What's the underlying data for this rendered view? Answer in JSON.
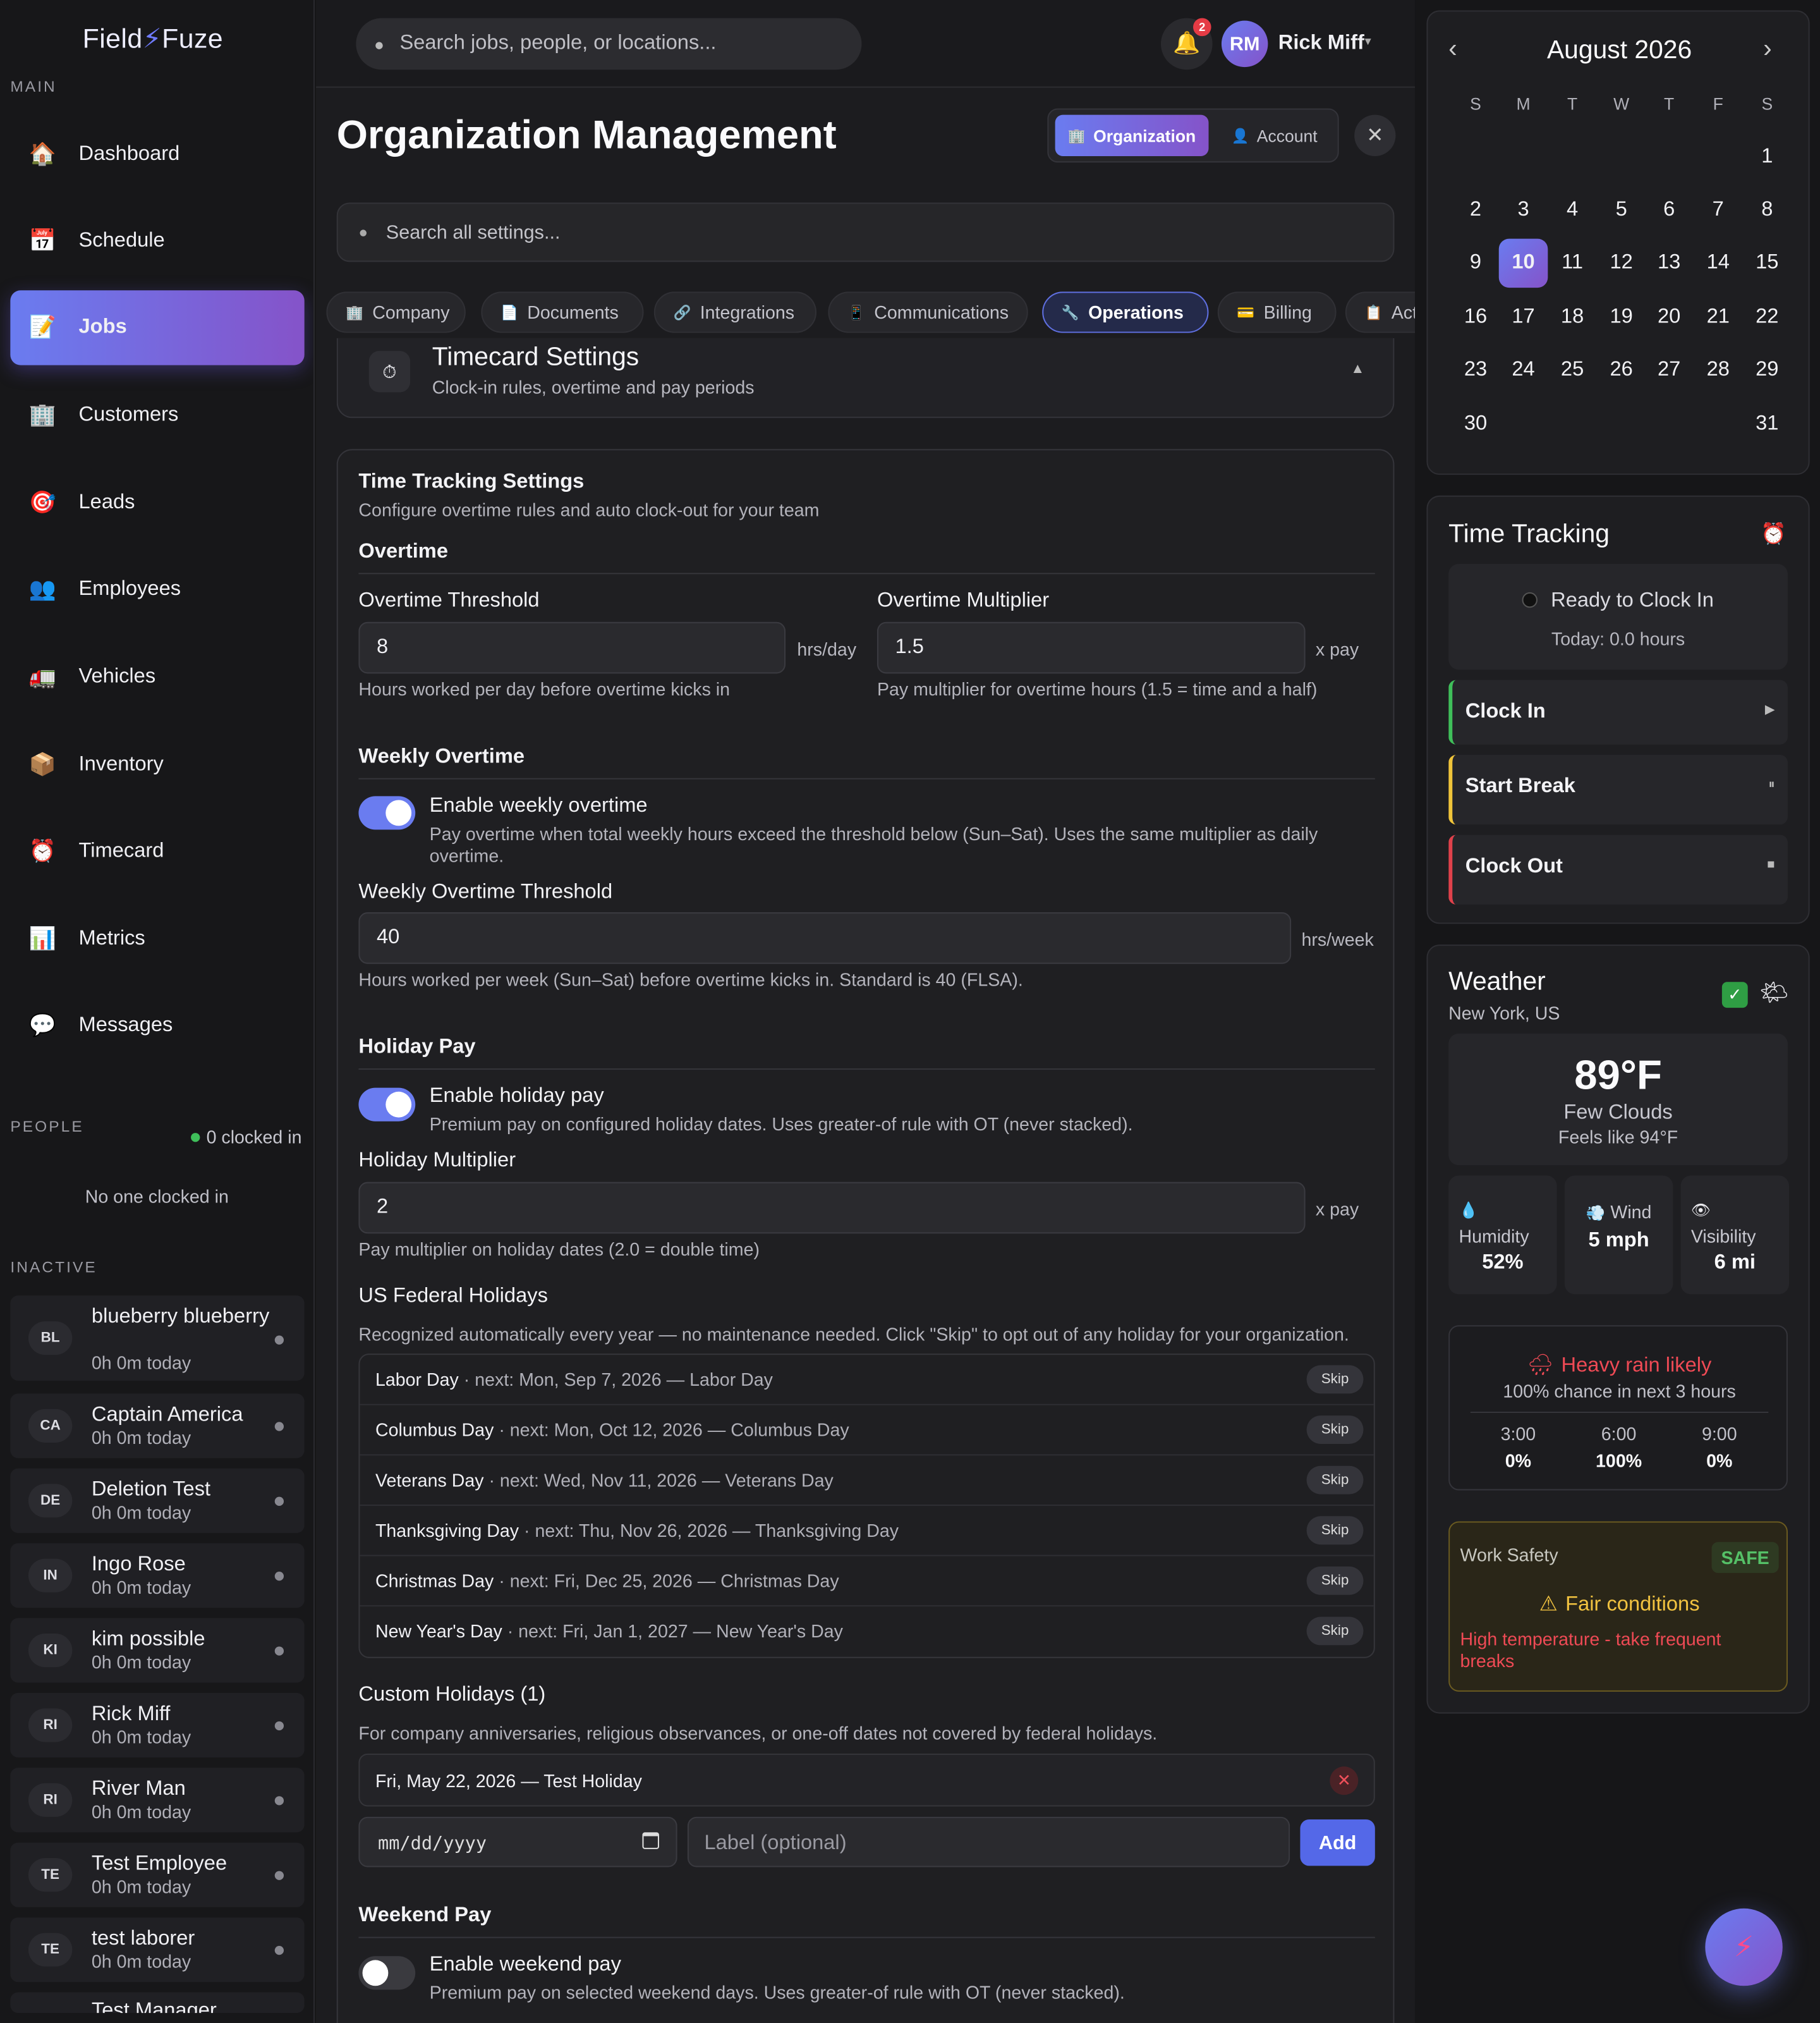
{
  "app": {
    "logo_a": "Field",
    "logo_bolt": "⚡",
    "logo_b": "Fuze"
  },
  "sidebar": {
    "main_label": "MAIN",
    "items": [
      {
        "label": "Dashboard",
        "icon": "🏠"
      },
      {
        "label": "Schedule",
        "icon": "📅"
      },
      {
        "label": "Jobs",
        "icon": "📝"
      },
      {
        "label": "Customers",
        "icon": "🏢"
      },
      {
        "label": "Leads",
        "icon": "🎯"
      },
      {
        "label": "Employees",
        "icon": "👥"
      },
      {
        "label": "Vehicles",
        "icon": "🚛"
      },
      {
        "label": "Inventory",
        "icon": "📦"
      },
      {
        "label": "Timecard",
        "icon": "⏰"
      },
      {
        "label": "Metrics",
        "icon": "📊"
      },
      {
        "label": "Messages",
        "icon": "💬"
      }
    ],
    "people_label": "PEOPLE",
    "clocked_in": "0 clocked in",
    "no_one": "No one clocked in",
    "inactive_label": "INACTIVE",
    "employees": [
      {
        "initials": "BL",
        "name": "blueberry blueberry",
        "status": "0h 0m today"
      },
      {
        "initials": "CA",
        "name": "Captain America",
        "status": "0h 0m today"
      },
      {
        "initials": "DE",
        "name": "Deletion Test",
        "status": "0h 0m today"
      },
      {
        "initials": "IN",
        "name": "Ingo Rose",
        "status": "0h 0m today"
      },
      {
        "initials": "KI",
        "name": "kim possible",
        "status": "0h 0m today"
      },
      {
        "initials": "RI",
        "name": "Rick Miff",
        "status": "0h 0m today"
      },
      {
        "initials": "RI",
        "name": "River Man",
        "status": "0h 0m today"
      },
      {
        "initials": "TE",
        "name": "Test Employee",
        "status": "0h 0m today"
      },
      {
        "initials": "TE",
        "name": "test laborer",
        "status": "0h 0m today"
      },
      {
        "initials": "TE",
        "name": "Test Manager",
        "status": ""
      }
    ]
  },
  "topbar": {
    "search_placeholder": "Search jobs, people, or locations...",
    "notif_count": "2",
    "user_initials": "RM",
    "user_name": "Rick Miff",
    "caret": "▾"
  },
  "page": {
    "title": "Organization Management",
    "seg_org": "Organization",
    "seg_account": "Account",
    "close": "✕",
    "settings_search_placeholder": "Search all settings..."
  },
  "tabs": [
    {
      "label": "Company",
      "icon": "🏢"
    },
    {
      "label": "Documents",
      "icon": "📄"
    },
    {
      "label": "Integrations",
      "icon": "🔗"
    },
    {
      "label": "Communications",
      "icon": "📱"
    },
    {
      "label": "Operations",
      "icon": "🔧"
    },
    {
      "label": "Billing",
      "icon": "💳"
    },
    {
      "label": "Act",
      "icon": "📋"
    }
  ],
  "timecard": {
    "title": "Timecard Settings",
    "subtitle": "Clock-in rules, overtime and pay periods",
    "icon": "⏱",
    "chevron": "▲"
  },
  "tracking": {
    "title": "Time Tracking Settings",
    "subtitle": "Configure overtime rules and auto clock-out for your team",
    "overtime_heading": "Overtime",
    "threshold_label": "Overtime Threshold",
    "threshold_value": "8",
    "threshold_unit": "hrs/day",
    "threshold_help": "Hours worked per day before overtime kicks in",
    "multiplier_label": "Overtime Multiplier",
    "multiplier_value": "1.5",
    "multiplier_unit": "x pay",
    "multiplier_help": "Pay multiplier for overtime hours (1.5 = time and a half)",
    "weekly_heading": "Weekly Overtime",
    "weekly_toggle_label": "Enable weekly overtime",
    "weekly_toggle_on": true,
    "weekly_toggle_help": "Pay overtime when total weekly hours exceed the threshold below (Sun–Sat). Uses the same multiplier as daily overtime.",
    "weekly_threshold_label": "Weekly Overtime Threshold",
    "weekly_threshold_value": "40",
    "weekly_threshold_unit": "hrs/week",
    "weekly_threshold_help": "Hours worked per week (Sun–Sat) before overtime kicks in. Standard is 40 (FLSA).",
    "holiday_heading": "Holiday Pay",
    "holiday_toggle_label": "Enable holiday pay",
    "holiday_toggle_on": true,
    "holiday_toggle_help": "Premium pay on configured holiday dates. Uses greater-of rule with OT (never stacked).",
    "holiday_mult_label": "Holiday Multiplier",
    "holiday_mult_value": "2",
    "holiday_mult_unit": "x pay",
    "holiday_mult_help": "Pay multiplier on holiday dates (2.0 = double time)",
    "federal_heading": "US Federal Holidays",
    "federal_help": "Recognized automatically every year — no maintenance needed. Click \"Skip\" to opt out of any holiday for your organization.",
    "holidays": [
      {
        "name": "Labor Day",
        "detail": " · next: Mon, Sep 7, 2026 — Labor Day"
      },
      {
        "name": "Columbus Day",
        "detail": " · next: Mon, Oct 12, 2026 — Columbus Day"
      },
      {
        "name": "Veterans Day",
        "detail": " · next: Wed, Nov 11, 2026 — Veterans Day"
      },
      {
        "name": "Thanksgiving Day",
        "detail": " · next: Thu, Nov 26, 2026 — Thanksgiving Day"
      },
      {
        "name": "Christmas Day",
        "detail": " · next: Fri, Dec 25, 2026 — Christmas Day"
      },
      {
        "name": "New Year's Day",
        "detail": " · next: Fri, Jan 1, 2027 — New Year's Day"
      }
    ],
    "skip_label": "Skip",
    "custom_heading": "Custom Holidays (1)",
    "custom_help": "For company anniversaries, religious observances, or one-off dates not covered by federal holidays.",
    "custom_item": "Fri, May 22, 2026 — Test Holiday",
    "date_placeholder": "mm/dd/yyyy",
    "label_placeholder": "Label (optional)",
    "add_label": "Add",
    "weekend_heading": "Weekend Pay",
    "weekend_toggle_label": "Enable weekend pay",
    "weekend_toggle_on": false,
    "weekend_toggle_help": "Premium pay on selected weekend days. Uses greater-of rule with OT (never stacked)."
  },
  "calendar": {
    "month": "August 2026",
    "prev": "‹",
    "next": "›",
    "weekdays": [
      "S",
      "M",
      "T",
      "W",
      "T",
      "F",
      "S"
    ],
    "weeks": [
      [
        "",
        "",
        "",
        "",
        "",
        "",
        "1"
      ],
      [
        "2",
        "3",
        "4",
        "5",
        "6",
        "7",
        "8"
      ],
      [
        "9",
        "10",
        "11",
        "12",
        "13",
        "14",
        "15"
      ],
      [
        "16",
        "17",
        "18",
        "19",
        "20",
        "21",
        "22"
      ],
      [
        "23",
        "24",
        "25",
        "26",
        "27",
        "28",
        "29"
      ],
      [
        "30",
        "",
        "",
        "",
        "",
        "",
        "31"
      ]
    ],
    "selected": "10"
  },
  "time_tracking": {
    "title": "Time Tracking",
    "icon": "⏰",
    "status": "Ready to Clock In",
    "today": "Today: 0.0 hours",
    "clock_in": "Clock In",
    "clock_in_icon": "▶",
    "start_break": "Start Break",
    "break_icon": "⏸",
    "clock_out": "Clock Out",
    "clock_out_icon": "■",
    "colors": {
      "clock_in": "#3fbf5a",
      "start_break": "#f0c43a",
      "clock_out": "#e0414b"
    }
  },
  "weather": {
    "title": "Weather",
    "location": "New York, US",
    "check": "✓",
    "sun": "🌤",
    "temp": "89°F",
    "cond": "Few Clouds",
    "feels": "Feels like 94°F",
    "humidity_label": "Humidity",
    "humidity_value": "52%",
    "humidity_icon": "💧",
    "wind_label": "Wind",
    "wind_value": "5 mph",
    "wind_icon": "💨",
    "vis_label": "Visibility",
    "vis_value": "6 mi",
    "vis_icon": "👁",
    "rain_icon": "🌧",
    "rain_title": "Heavy rain likely",
    "rain_sub": "100% chance in next 3 hours",
    "hours": [
      {
        "t": "3:00",
        "p": "0%"
      },
      {
        "t": "6:00",
        "p": "100%"
      },
      {
        "t": "9:00",
        "p": "0%"
      }
    ],
    "safety_label": "Work Safety",
    "safety_badge": "SAFE",
    "safety_icon": "⚠",
    "safety_title": "Fair conditions",
    "safety_note": "High temperature - take frequent breaks"
  },
  "fab_icon": "⚡"
}
